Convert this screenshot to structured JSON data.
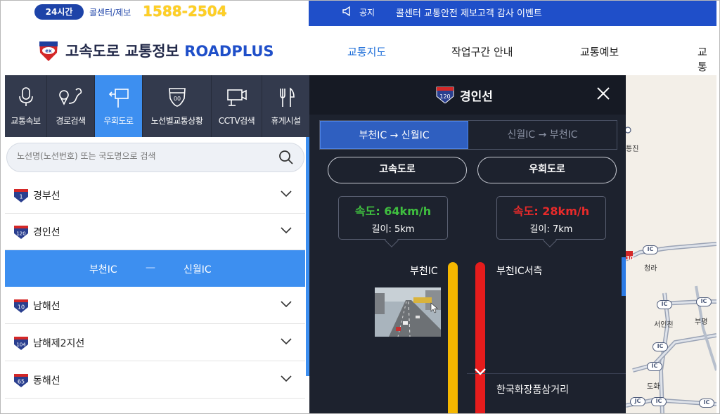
{
  "topbar": {
    "badge": "24시간",
    "call_label": "콜센터/제보",
    "call_number": "1588-2504",
    "notice_label": "공지",
    "notice_text": "콜센터 교통안전 제보고객 감사 이벤트"
  },
  "header": {
    "logo_text": "고속도로 교통정보",
    "logo_brand": "ROADPLUS",
    "nav": [
      "교통지도",
      "작업구간 안내",
      "교통예보",
      "교통"
    ]
  },
  "tabs": [
    {
      "label": "교통속보",
      "icon": "microphone-icon"
    },
    {
      "label": "경로검색",
      "icon": "route-icon"
    },
    {
      "label": "우회도로",
      "icon": "detour-sign-icon"
    },
    {
      "label": "노선별교통상황",
      "icon": "highway-shield-icon"
    },
    {
      "label": "CCTV검색",
      "icon": "cctv-camera-icon"
    },
    {
      "label": "휴게시설",
      "icon": "fork-knife-icon"
    }
  ],
  "search": {
    "placeholder": "노선명(노선번호) 또는 국도명으로 검색"
  },
  "routes": [
    {
      "number": "1",
      "name": "경부선"
    },
    {
      "number": "120",
      "name": "경인선"
    },
    {
      "number": "10",
      "name": "남해선"
    },
    {
      "number": "104",
      "name": "남해제2지선"
    },
    {
      "number": "65",
      "name": "동해선"
    }
  ],
  "selected_section": {
    "from": "부천IC",
    "separator": "—",
    "to": "신월IC"
  },
  "detail": {
    "shield_number": "120",
    "title": "경인선",
    "direction_active": "부천IC → 신월IC",
    "direction_inactive": "신월IC → 부천IC",
    "pill_highway": "고속도로",
    "pill_detour": "우회도로",
    "left_info": {
      "speed": "속도: 64km/h",
      "length": "길이: 5km",
      "color": "#3fbf3f"
    },
    "right_info": {
      "speed": "속도: 28km/h",
      "length": "길이: 7km",
      "color": "#e82a2a"
    },
    "left_start": "부천IC",
    "right_start": "부천IC서측",
    "right_next": "한국화장품삼거리",
    "highway_bar_color": "#f5b700",
    "detour_bar_color": "#e51c1c"
  },
  "map": {
    "labels": [
      "통진",
      "청라",
      "서인천",
      "부평",
      "도화"
    ],
    "ic_label": "IC",
    "jc_label": "JC",
    "route_tag": "30"
  }
}
